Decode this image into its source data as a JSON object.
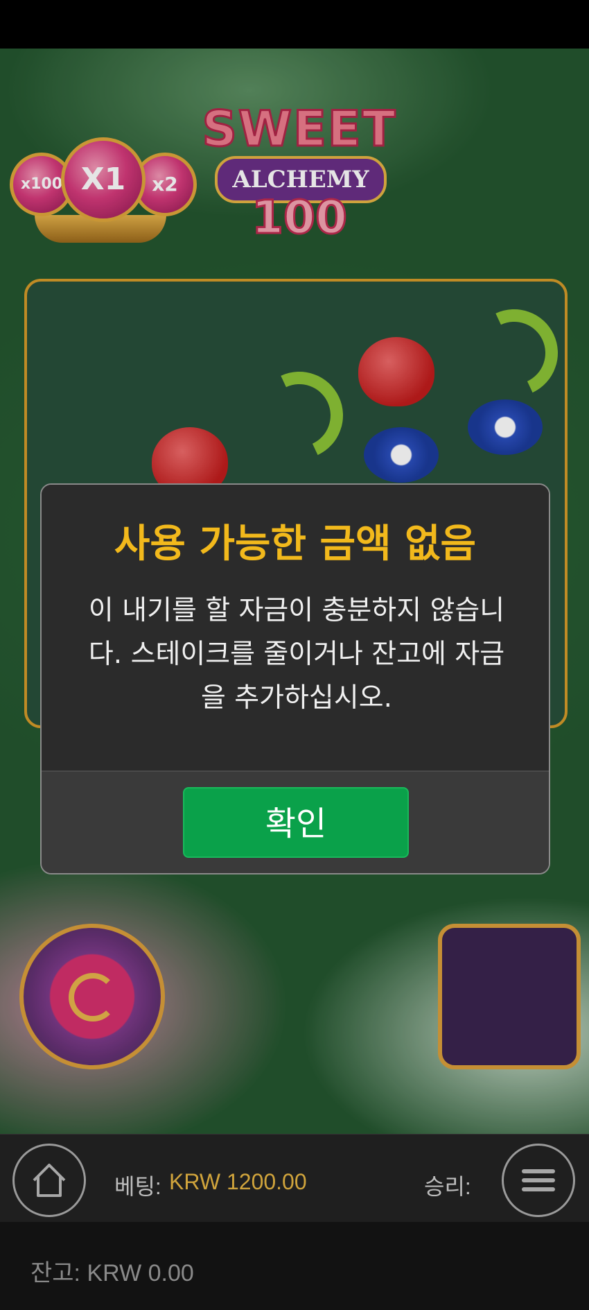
{
  "game": {
    "logo": {
      "line1": "SWEET",
      "line2": "ALCHEMY",
      "line3": "100"
    },
    "multipliers": [
      "x100",
      "X1",
      "x2"
    ]
  },
  "dialog": {
    "title": "사용 가능한 금액 없음",
    "message": "이 내기를 할 자금이 충분하지 않습니다. 스테이크를 줄이거나 잔고에 자금을 추가하십시오.",
    "ok_label": "확인"
  },
  "hud": {
    "bet_label": "베팅:",
    "bet_value": "KRW 1200.00",
    "win_label": "승리:",
    "balance": "잔고: KRW 0.00"
  },
  "colors": {
    "title": "#f2b91c",
    "ok_button": "#0aa14a",
    "bet_value": "#d0a43c"
  }
}
